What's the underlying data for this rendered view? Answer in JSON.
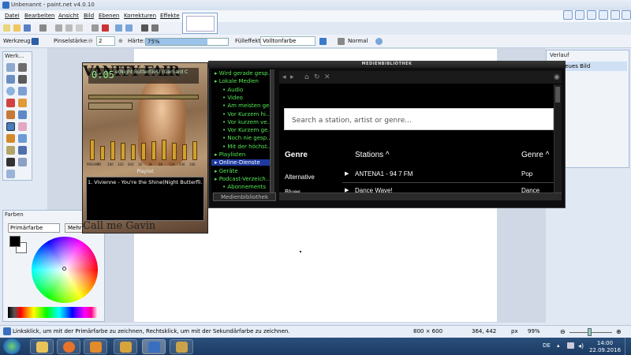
{
  "paintnet": {
    "title": "Unbenannt - paint.net v4.0.10",
    "menu": [
      "Datei",
      "Bearbeiten",
      "Ansicht",
      "Bild",
      "Ebenen",
      "Korrekturen",
      "Effekte"
    ],
    "toolbar": {
      "tool_label": "Werkzeug:",
      "brush_width_label": "Pinselstärke:",
      "brush_width_value": "2",
      "hardness_label": "Härte:",
      "hardness_value": "75%",
      "hardness_fraction": 0.75,
      "fill_label": "Fülleffekt:",
      "fill_value": "Volltonfarbe",
      "blend_value": "Normal"
    },
    "tools_panel": {
      "title": "Werk..."
    },
    "colors_panel": {
      "title": "Farben",
      "select_value": "Primärfarbe",
      "more_button": "Mehr",
      "primary_color": "#000000",
      "secondary_color": "#ffffff"
    },
    "history_panel": {
      "title": "Verlauf",
      "items": [
        "Neues Bild"
      ]
    },
    "status": {
      "hint": "Linksklick, um mit der Primärfarbe zu zeichnen, Rechtsklick, um mit der Sekundärfarbe zu zeichnen.",
      "image_size": "800 × 600",
      "cursor_pos": "364, 442",
      "unit": "px",
      "zoom": "99%"
    }
  },
  "winamp": {
    "time": "0:05",
    "marquee": "e(Night Butterflies) (Gerhard C",
    "playlist_title": "Playlist",
    "playlist_items": [
      "1. Vivienne - You're the Shine(Night Butterfli..."
    ],
    "skin_top_text": "VANITY FAIR",
    "skin_bottom_text": "Call me Gavin",
    "eq_labels": [
      "PREAMP",
      "70",
      "180",
      "320",
      "600",
      "1K",
      "3K",
      "6K",
      "12K",
      "14K",
      "16K"
    ],
    "eq_levels": [
      0.6,
      0.4,
      0.55,
      0.5,
      0.45,
      0.5,
      0.55,
      0.6,
      0.5,
      0.45,
      0.55
    ]
  },
  "medialib": {
    "title": "MEDIENBIBLIOTHEK",
    "tree": [
      "Wird gerade gesp...",
      "Lokale Medien",
      "Audio",
      "Video",
      "Am meisten ge...",
      "Vor Kurzem hi...",
      "Vor kurzem ve...",
      "Vor Kurzem ge...",
      "Noch nie gesp...",
      "Mit der höchst...",
      "Playlisten",
      "Online-Dienste",
      "Geräte",
      "Podcast-Verzeich...",
      "Abonnements"
    ],
    "selected_tree_item": "Online-Dienste",
    "bottom_button": "Medienbibliothek",
    "search_placeholder": "Search a station, artist or genre...",
    "genre_header": "Genre",
    "stations_header": "Stations ^",
    "genre_col_header": "Genre ^",
    "genres": [
      "Alternative",
      "Blues"
    ],
    "stations": [
      {
        "name": "ANTENA1 - 94 7 FM",
        "genre": "Pop"
      },
      {
        "name": "Dance Wave!",
        "genre": "Dance"
      }
    ]
  },
  "taskbar": {
    "apps": [
      "explorer",
      "firefox",
      "media-player",
      "winamp",
      "paint.net",
      "paint-tool"
    ],
    "lang": "DE",
    "time": "14:00",
    "date": "22.09.2016"
  },
  "colors": {
    "paintnet_bg": "#dfe8f3",
    "medialib_green": "#55e855",
    "medialib_select": "#1e3aa0",
    "taskbar": "#1b3b63"
  }
}
